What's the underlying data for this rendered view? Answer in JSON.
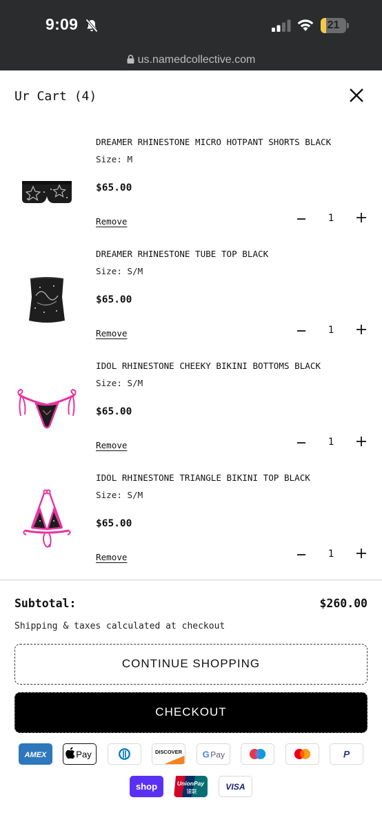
{
  "status_bar": {
    "time": "9:09",
    "battery_level": "21",
    "battery_fraction": 0.21
  },
  "browser": {
    "url": "us.namedcollective.com"
  },
  "cart": {
    "title": "Ur Cart (4)",
    "remove_label": "Remove",
    "items": [
      {
        "name": "DREAMER RHINESTONE MICRO HOTPANT SHORTS BLACK",
        "size": "Size: M",
        "price": "$65.00",
        "qty": "1",
        "image": "black-rhinestone-shorts"
      },
      {
        "name": "DREAMER RHINESTONE TUBE TOP BLACK",
        "size": "Size: S/M",
        "price": "$65.00",
        "qty": "1",
        "image": "black-rhinestone-tube-top"
      },
      {
        "name": "IDOL RHINESTONE CHEEKY BIKINI BOTTOMS BLACK",
        "size": "Size: S/M",
        "price": "$65.00",
        "qty": "1",
        "image": "pink-black-bikini-bottom"
      },
      {
        "name": "IDOL RHINESTONE TRIANGLE BIKINI TOP BLACK",
        "size": "Size: S/M",
        "price": "$65.00",
        "qty": "1",
        "image": "pink-black-bikini-top"
      }
    ],
    "subtotal_label": "Subtotal:",
    "subtotal_value": "$260.00",
    "shipping_note": "Shipping & taxes calculated at checkout",
    "continue_label": "CONTINUE SHOPPING",
    "checkout_label": "CHECKOUT"
  },
  "payment_methods": {
    "amex": "AMEX",
    "apple_pay": "Pay",
    "diners": "diners-club-icon",
    "discover": "DISCOVER",
    "google_pay": "Pay",
    "maestro": "maestro-icon",
    "mastercard": "mastercard-icon",
    "paypal": "P",
    "shop_pay": "shop",
    "unionpay": "UnionPay",
    "unionpay_cn": "银联",
    "visa": "VISA"
  },
  "colors": {
    "topbar": "#2b2c2e",
    "accent_pink": "#e5359f",
    "checkout_bg": "#000000",
    "battery_fill": "#f2c94c"
  }
}
